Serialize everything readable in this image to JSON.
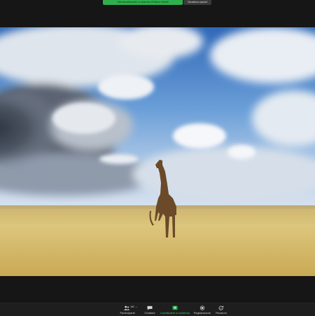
{
  "top": {
    "share_banner": "Stai visualizzando lo schermo di Marco Gentili",
    "view_options": "Visualizza opzioni"
  },
  "toolbar": {
    "participants_label": "Partecipanti",
    "participants_count": "182",
    "chat_label": "Chattare",
    "share_label": "Condividere lo schermo",
    "record_label": "Registrazione",
    "reactions_label": "Reazioni"
  },
  "colors": {
    "share_accent": "#2fb04f",
    "background": "#161616"
  },
  "icons": [
    "people-icon",
    "chat-icon",
    "share-screen-icon",
    "record-icon",
    "reactions-icon"
  ]
}
